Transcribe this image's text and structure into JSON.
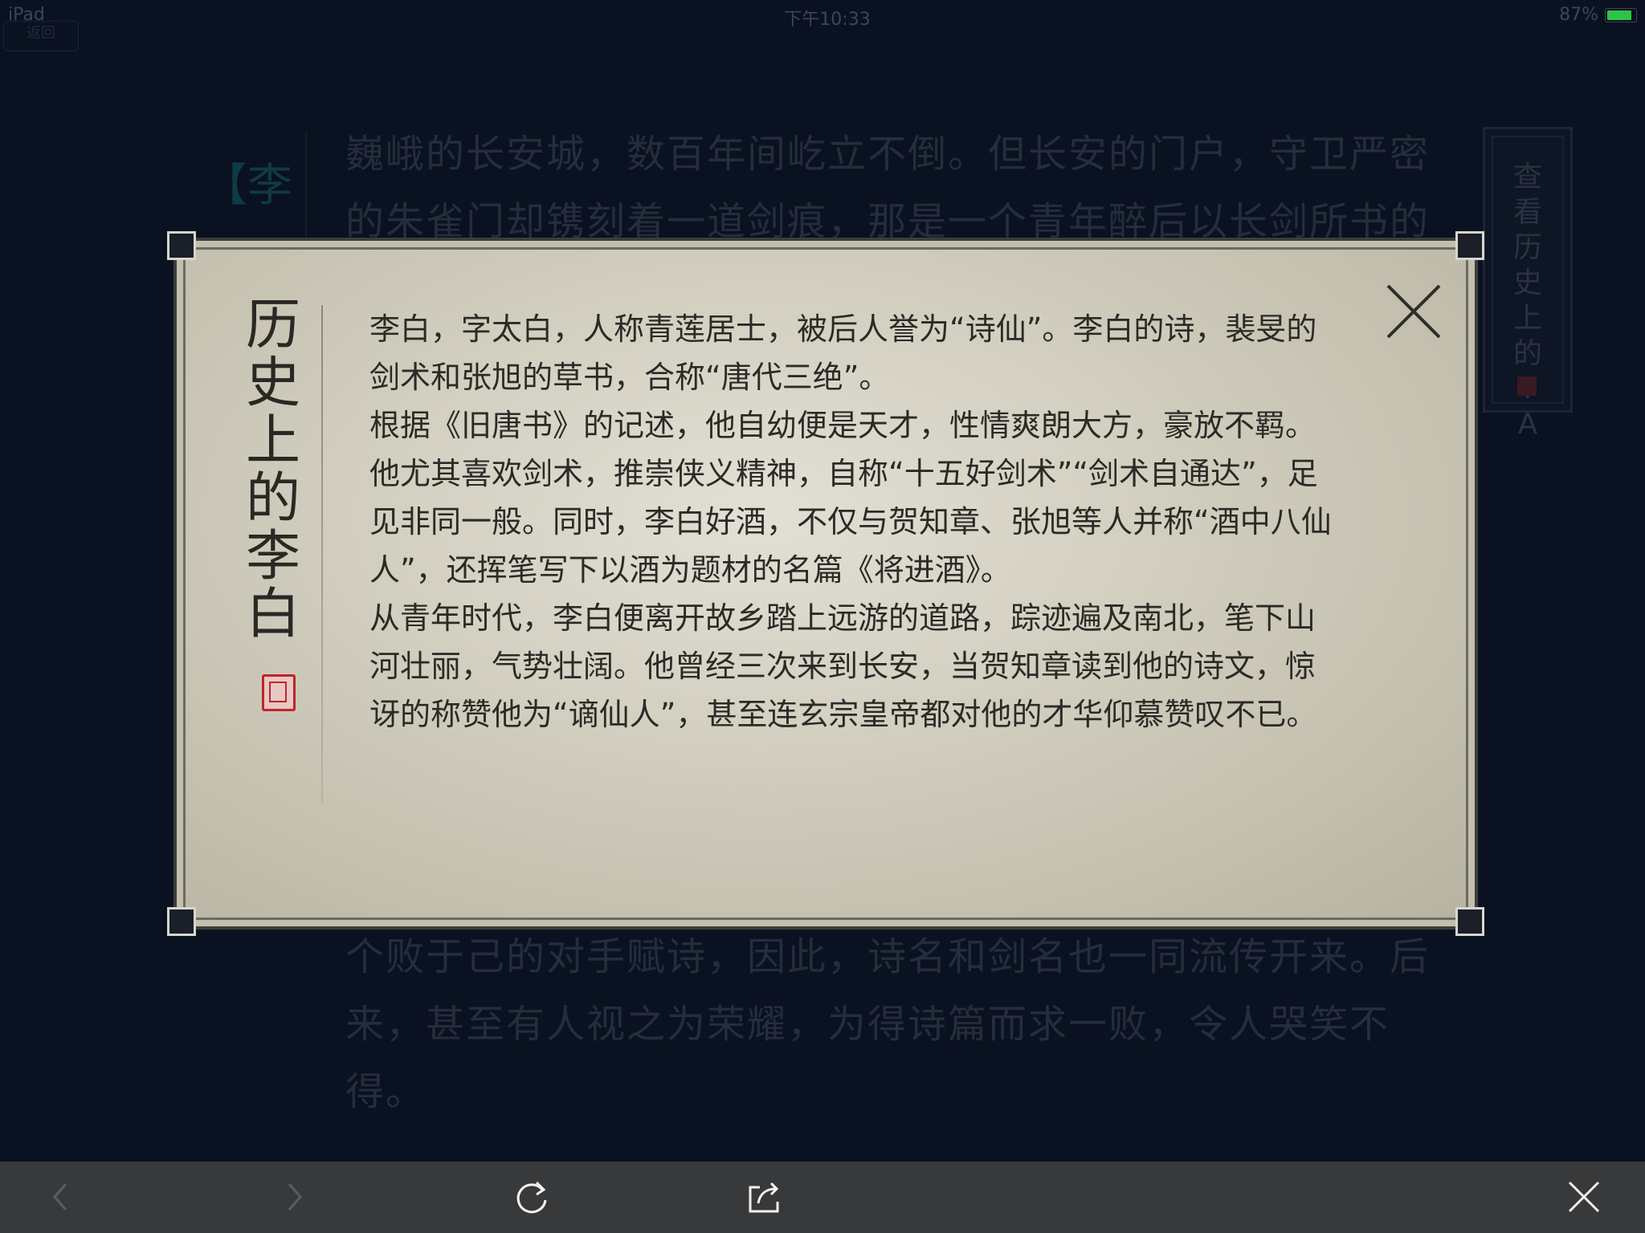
{
  "status_bar": {
    "device": "iPad",
    "time": "下午10:33",
    "battery": "87%",
    "back_label": "返回"
  },
  "background": {
    "vertical_title": "【李",
    "paragraph_top": "巍峨的长安城，数百年间屹立不倒。但长安的门户，守卫严密的朱雀门却镌刻着一道剑痕，那是一个青年醉后以长剑所书的",
    "paragraph_bottom": "个败于己的对手赋诗，因此，诗名和剑名也一同流传开来。后来，甚至有人视之为荣耀，为得诗篇而求一败，令人哭笑不得。"
  },
  "side_button": {
    "label": "查看历史上的TA"
  },
  "modal": {
    "title": "历史上的李白",
    "paragraphs": [
      "李白，字太白，人称青莲居士，被后人誉为“诗仙”。李白的诗，裴旻的剑术和张旭的草书，合称“唐代三绝”。",
      "根据《旧唐书》的记述，他自幼便是天才，性情爽朗大方，豪放不羁。他尤其喜欢剑术，推崇侠义精神，自称“十五好剑术”“剑术自通达”，足见非同一般。同时，李白好酒，不仅与贺知章、张旭等人并称“酒中八仙人”，还挥笔写下以酒为题材的名篇《将进酒》。",
      "从青年时代，李白便离开故乡踏上远游的道路，踪迹遍及南北，笔下山河壮丽，气势壮阔。他曾经三次来到长安，当贺知章读到他的诗文，惊讶的称赞他为“谪仙人”，甚至连玄宗皇帝都对他的才华仰慕赞叹不已。"
    ]
  },
  "toolbar": {
    "icons": [
      "back-arrow-icon",
      "forward-arrow-icon",
      "refresh-icon",
      "share-icon",
      "close-icon"
    ]
  },
  "colors": {
    "background": "#0a1120",
    "modal_paper": "#d0ccbd",
    "seal_red": "#c0242a",
    "toolbar": "#38393b",
    "battery_green": "#2fc249"
  }
}
